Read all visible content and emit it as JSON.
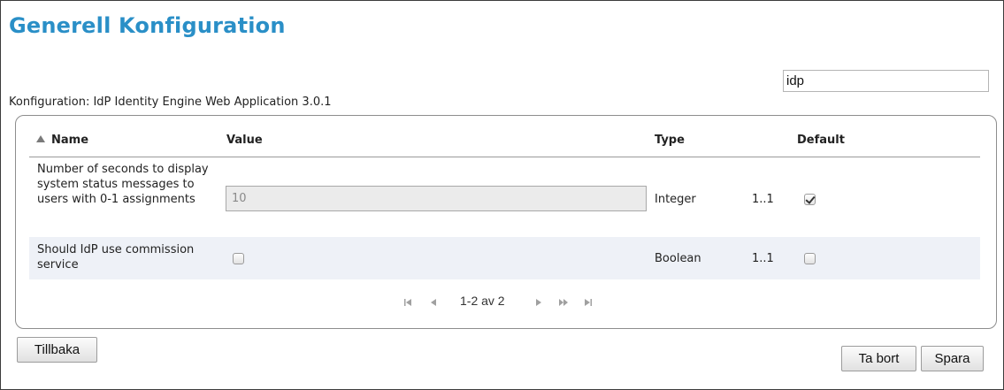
{
  "page": {
    "title": "Generell Konfiguration",
    "search_value": "idp",
    "config_label": "Konfiguration: IdP Identity Engine Web Application 3.0.1"
  },
  "table": {
    "headers": {
      "name": "Name",
      "value": "Value",
      "type": "Type",
      "default": "Default"
    },
    "rows": [
      {
        "name": "Number of seconds to display system status messages to users with 0-1 assignments",
        "value": "10",
        "type": "Integer",
        "multiplicity": "1..1",
        "default_checked": true
      },
      {
        "name": "Should IdP use commission service",
        "value_checked": false,
        "type": "Boolean",
        "multiplicity": "1..1",
        "default_checked": false
      }
    ]
  },
  "pager": {
    "text": "1-2 av 2",
    "icons": [
      "first-page-icon",
      "previous-page-icon",
      "next-page-icon",
      "fast-forward-icon",
      "last-page-icon"
    ]
  },
  "buttons": {
    "back": "Tillbaka",
    "delete": "Ta bort",
    "save": "Spara"
  },
  "colors": {
    "title": "#2a8fc7",
    "alt_row": "#eef1f7"
  }
}
